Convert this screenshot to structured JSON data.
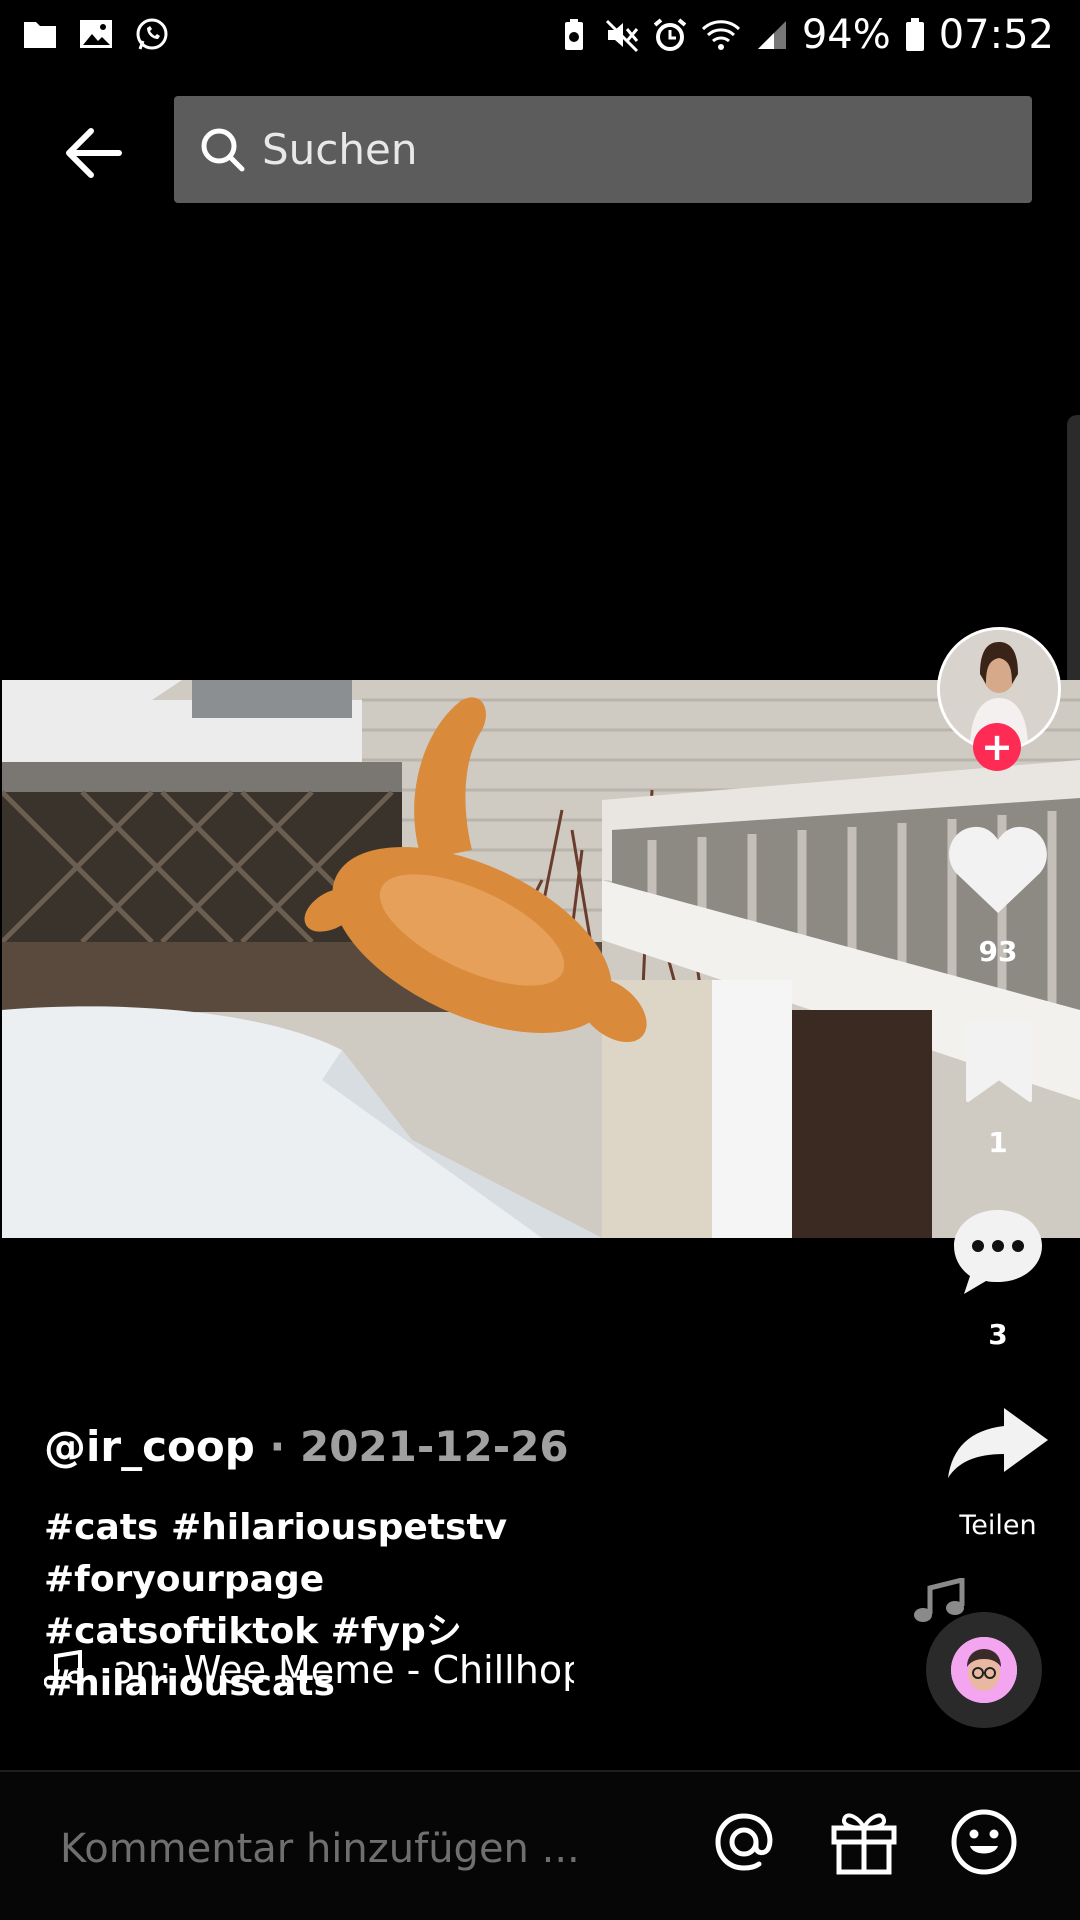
{
  "status_bar": {
    "battery": "94%",
    "time": "07:52"
  },
  "search": {
    "placeholder": "Suchen"
  },
  "actions": {
    "likes": "93",
    "bookmarks": "1",
    "comments": "3",
    "share_label": "Teilen"
  },
  "post": {
    "username": "@ir_coop",
    "separator": " · ",
    "date": "2021-12-26",
    "hashtags_line1": "#cats #hilariouspetstv #foryourpage",
    "hashtags_line2": "#catsoftiktok #fypシ #hilariouscats",
    "music": "ɔn: Wee Meme - Chillhop I"
  },
  "comment": {
    "placeholder": "Kommentar hinzufügen ..."
  },
  "colors": {
    "accent": "#fe2c55",
    "search_bg": "#5c5c5c"
  }
}
